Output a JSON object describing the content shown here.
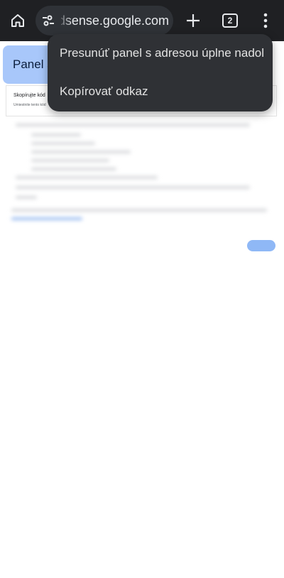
{
  "toolbar": {
    "url_text": "adsense.google.com",
    "tab_count": "2"
  },
  "page": {
    "chip_label": "Panel s",
    "card_title": "Skopírujte kód",
    "card_subtitle": "Umiestnite tento kód"
  },
  "menu": {
    "items": [
      {
        "label": "Presunúť panel s adresou úplne nadol"
      },
      {
        "label": "Kopírovať odkaz"
      }
    ]
  },
  "colors": {
    "toolbar_bg": "#1f2023",
    "omnibox_bg": "#2f3237",
    "menu_bg": "#2f3135",
    "chip_bg": "#a8c7fa"
  }
}
